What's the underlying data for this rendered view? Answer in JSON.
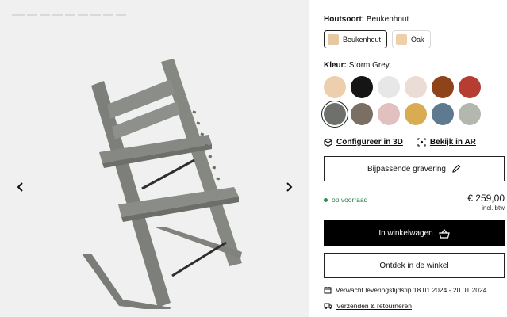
{
  "gallery": {
    "prev_icon": "chevron-left-icon",
    "next_icon": "chevron-right-icon",
    "product_image_alt": "Tripp Trapp chair Storm Grey"
  },
  "wood": {
    "label": "Houtsoort:",
    "value": "Beukenhout",
    "options": [
      {
        "label": "Beukenhout",
        "color": "#e7c8a3",
        "selected": true
      },
      {
        "label": "Oak",
        "color": "#efcfa8",
        "selected": false
      }
    ]
  },
  "color": {
    "label": "Kleur:",
    "value": "Storm Grey",
    "swatches": [
      {
        "name": "Natural",
        "hex": "#edcfae"
      },
      {
        "name": "Black",
        "hex": "#151515"
      },
      {
        "name": "White",
        "hex": "#e7e7e7"
      },
      {
        "name": "Whitewash",
        "hex": "#ecdcd6"
      },
      {
        "name": "Cognac",
        "hex": "#8e431a"
      },
      {
        "name": "Warm Red",
        "hex": "#b53d32"
      },
      {
        "name": "Storm Grey",
        "hex": "#6e706c",
        "selected": true
      },
      {
        "name": "Walnut Brown",
        "hex": "#7a6f62"
      },
      {
        "name": "Serene Pink",
        "hex": "#e2c0c0"
      },
      {
        "name": "Golden Yellow",
        "hex": "#d9ac52"
      },
      {
        "name": "Slate Blue",
        "hex": "#5e7a90"
      },
      {
        "name": "Sage Green",
        "hex": "#b3b7ad"
      }
    ]
  },
  "links": {
    "configure_3d": "Configureer in 3D",
    "view_ar": "Bekijk in AR"
  },
  "engraving_button": "Bijpassende gravering",
  "stock_status": "op voorraad",
  "price": {
    "amount": "€ 259,00",
    "vat_note": "incl. btw"
  },
  "add_to_cart_button": "In winkelwagen",
  "discover_store_button": "Ontdek in de winkel",
  "delivery": {
    "text": "Verwacht leveringstijdstip 18.01.2024 - 20.01.2024"
  },
  "shipping_link": "Verzenden & retourneren"
}
